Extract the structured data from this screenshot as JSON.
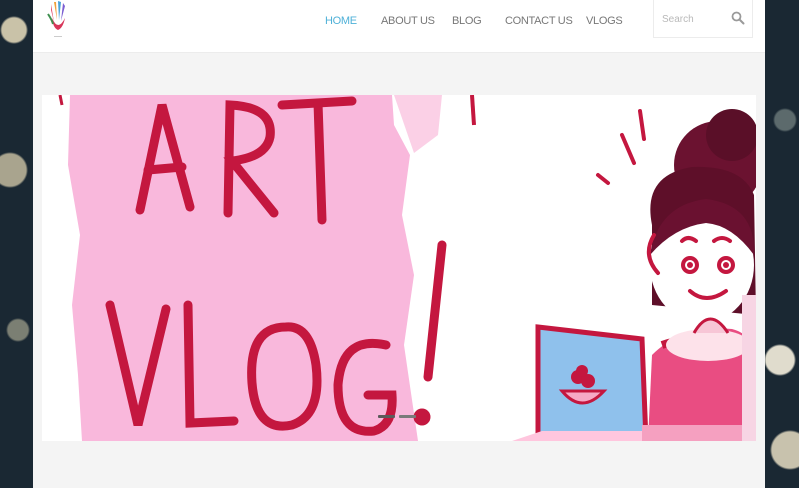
{
  "nav": {
    "items": [
      {
        "label": "HOME",
        "active": true
      },
      {
        "label": "ABOUT US",
        "active": false
      },
      {
        "label": "BLOG",
        "active": false
      },
      {
        "label": "CONTACT US",
        "active": false
      },
      {
        "label": "VLOGS",
        "active": false
      }
    ]
  },
  "search": {
    "placeholder": "Search",
    "icon": "search-icon"
  },
  "hero": {
    "banner_text_line1": "ART",
    "banner_text_line2": "VLOG!",
    "slide_count": 2,
    "active_slide": 1
  },
  "colors": {
    "accent": "#4fb1d8",
    "nav_text": "#777777",
    "banner_pink": "#f9b9dc",
    "banner_red": "#c4173f",
    "laptop_blue": "#8fc1ec"
  }
}
